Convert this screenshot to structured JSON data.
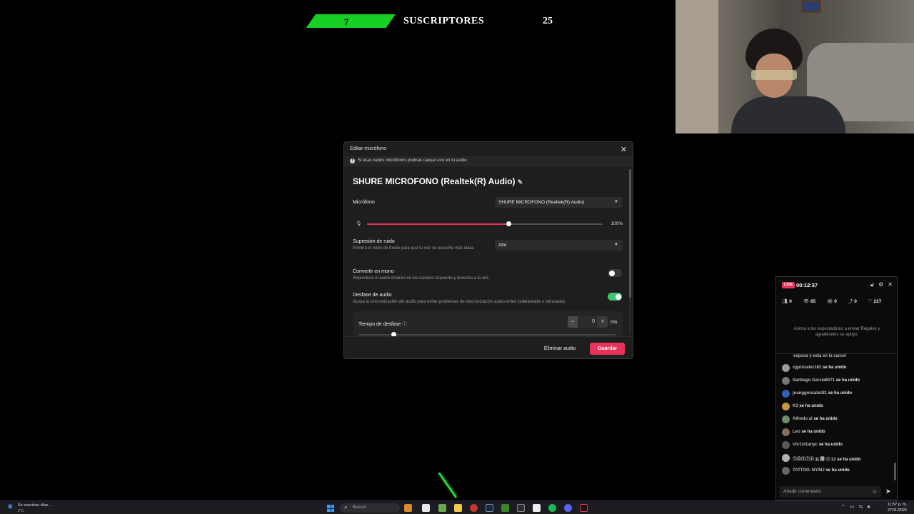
{
  "subscriber_goal": {
    "current": "7",
    "label": "SUSCRIPTORES",
    "goal": "25",
    "progress_fraction": 0.28,
    "bar_color": "#18d023"
  },
  "modal": {
    "title": "Editar micrófono",
    "close_icon": "close-icon",
    "warning": "Si usas varios micrófonos podrías causar eco en tu audio.",
    "mic_name": "SHURE MICROFONO (Realtek(R) Audio)",
    "microphone_label": "Micrófono",
    "microphone_selected": "SHURE MICROFONO (Realtek(R) Audio)",
    "volume_percent": "100%",
    "volume_fraction": 0.6,
    "noise_label": "Supresión de ruido",
    "noise_desc": "Elimina el ruido de fondo para que tu voz se escuche más clara.",
    "noise_selected": "Alto",
    "mono_label": "Convertir en mono",
    "mono_desc": "Reproduce el audio estéreo en los canales izquierdo y derecho a la vez.",
    "mono_enabled": false,
    "delay_label": "Desfase de audio",
    "delay_desc": "Ajusta la sincronización del audio para evitar problemas de sincronización audio-vídeo (adelantada o retrasada).",
    "delay_enabled": true,
    "offset_label": "Tiempo de desfase",
    "offset_value": "0",
    "offset_unit": "ms",
    "delete_button": "Eliminar audio",
    "save_button": "Guardar",
    "accent_color": "#e8325a",
    "toggle_on_color": "#3ec46d"
  },
  "live_panel": {
    "badge": "LIVE",
    "duration": "00:12:37",
    "stats": {
      "viewers_icon_count": "0",
      "views": "65",
      "gifts": "0",
      "shares": "0",
      "likes": "227"
    },
    "gift_message": "Anima a los espectadores a enviar Regalos y agradéceles su apoyo.",
    "partial_message": "esposa y esta en la carcel",
    "joined_suffix": "se ha unido",
    "chat": [
      {
        "user": "cjgonzalez182",
        "avatar_color": "#9a9a9a"
      },
      {
        "user": "Santiago Garcia6071",
        "avatar_color": "#777777"
      },
      {
        "user": "juanggonzalez81",
        "avatar_color": "#2f5fb8"
      },
      {
        "user": "K3",
        "avatar_color": "#c49a3a"
      },
      {
        "user": "Alfredo al",
        "avatar_color": "#6b8f6b"
      },
      {
        "user": "Leo",
        "avatar_color": "#8a6a5a"
      },
      {
        "user": "chr1st1anyc",
        "avatar_color": "#5a5a5a"
      },
      {
        "user": "ⓉⓄⒺⓉⓟ 🇪 🅱 ⚫12",
        "avatar_color": "#b0b0b0"
      },
      {
        "user": "TATTOO. NY/NJ",
        "avatar_color": "#666666"
      }
    ],
    "comment_placeholder": "Añadir comentario"
  },
  "taskbar": {
    "weather_line1": "Se avecinan días...",
    "weather_line2": "2°C",
    "search_placeholder": "Buscar",
    "time": "11:57 p. m.",
    "date": "27/11/2025"
  }
}
